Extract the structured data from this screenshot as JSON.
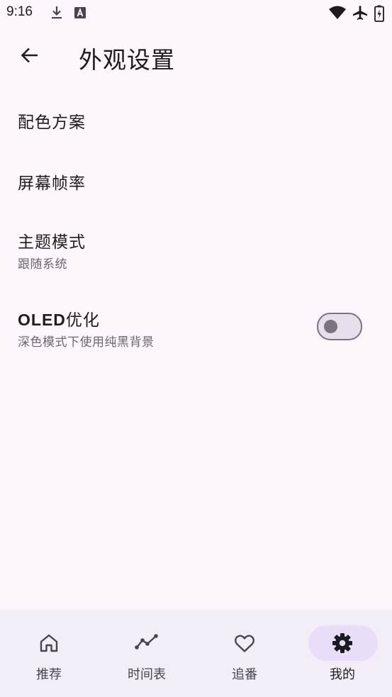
{
  "status_bar": {
    "time": "9:16",
    "icons_left": [
      "download-icon",
      "a-box-icon"
    ],
    "icons_right": [
      "wifi-icon",
      "airplane-icon",
      "battery-charging-icon"
    ]
  },
  "app_bar": {
    "back_icon": "arrow-back-icon",
    "title": "外观设置"
  },
  "settings": {
    "color_scheme": {
      "title": "配色方案"
    },
    "frame_rate": {
      "title": "屏幕帧率"
    },
    "theme_mode": {
      "title": "主题模式",
      "subtitle": "跟随系统"
    },
    "oled": {
      "title_latin": "OLED",
      "title_cjk": "优化",
      "subtitle": "深色模式下使用纯黑背景",
      "enabled": false
    }
  },
  "bottom_nav": {
    "items": [
      {
        "label": "推荐",
        "icon": "home-icon",
        "active": false
      },
      {
        "label": "时间表",
        "icon": "timeline-icon",
        "active": false
      },
      {
        "label": "追番",
        "icon": "heart-icon",
        "active": false
      },
      {
        "label": "我的",
        "icon": "gear-icon",
        "active": true
      }
    ]
  },
  "colors": {
    "background": "#fdf7fd",
    "nav_background": "#f3edf7",
    "active_indicator": "#e8def8",
    "text_primary": "#1d1b20",
    "text_secondary": "#6b6670",
    "outline": "#79747e"
  }
}
